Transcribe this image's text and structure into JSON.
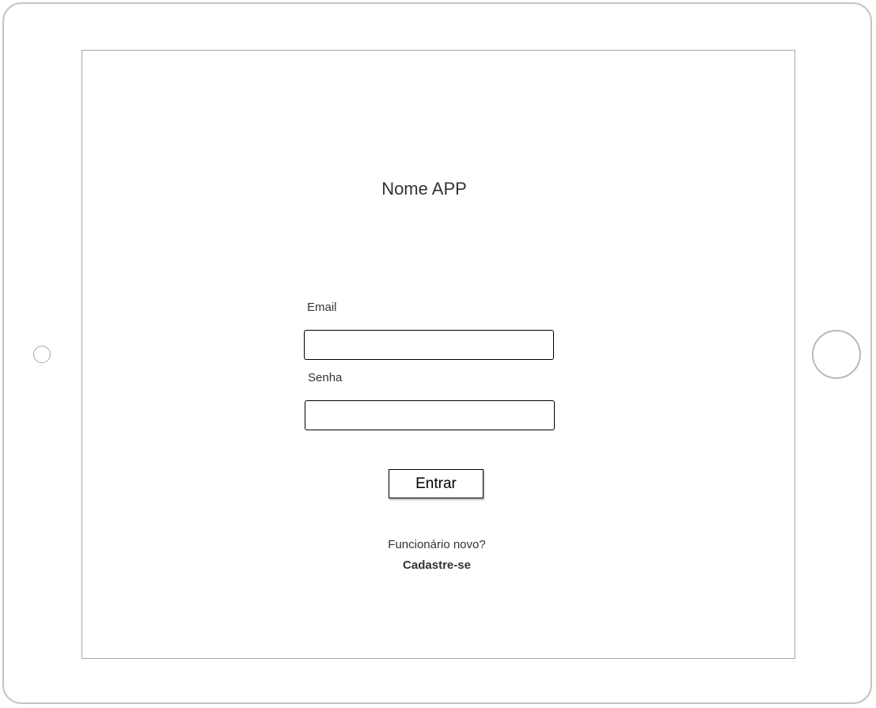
{
  "app": {
    "title": "Nome APP"
  },
  "login_form": {
    "email_label": "Email",
    "email_value": "",
    "password_label": "Senha",
    "password_value": "",
    "submit_label": "Entrar"
  },
  "signup": {
    "prompt": "Funcionário novo?",
    "link_label": "Cadastre-se"
  }
}
